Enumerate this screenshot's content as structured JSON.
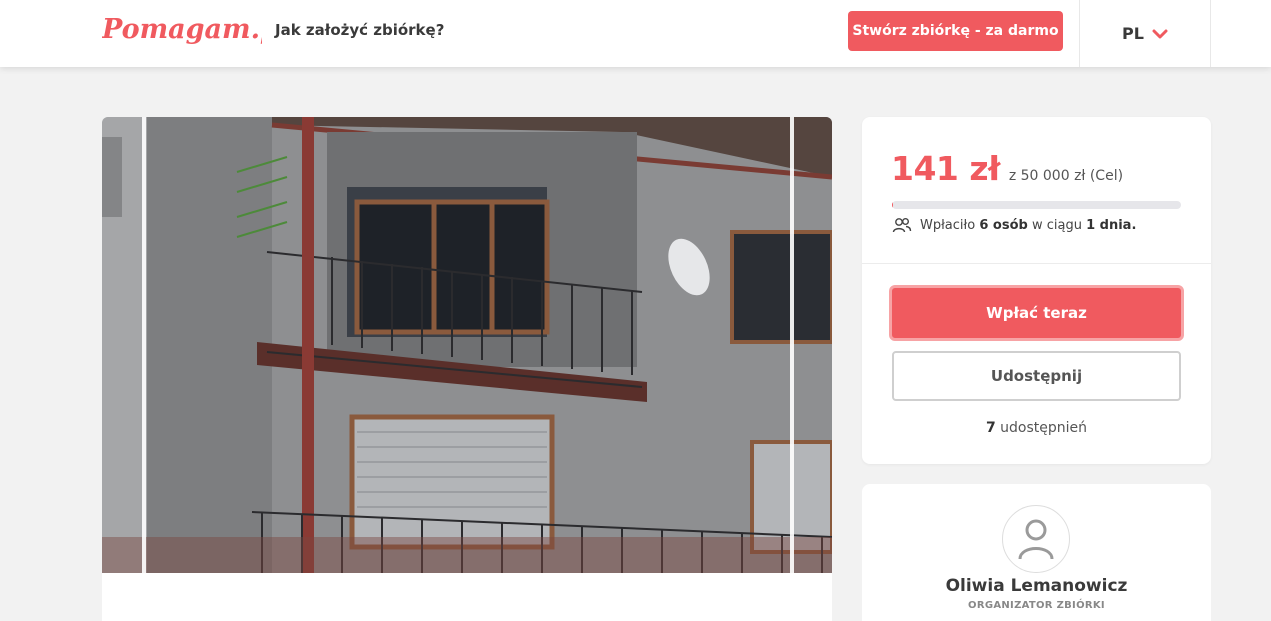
{
  "header": {
    "logo_text": "Pomagam.pl",
    "how_to_link": "Jak założyć zbiórkę?",
    "create_button": "Stwórz zbiórkę - za darmo",
    "language": "PL"
  },
  "campaign": {
    "photo_icon": "burnt-house-photo"
  },
  "donation": {
    "raised": "141 zł",
    "goal_text": "z 50 000 zł (Cel)",
    "progress_fraction": 0.003,
    "donors_prefix": "Wpłaciło",
    "donors_count": "6 osób",
    "donors_middle": "w ciągu",
    "days": "1 dnia.",
    "pay_button": "Wpłać teraz",
    "share_button": "Udostępnij",
    "shares_count": "7",
    "shares_label": "udostępnień"
  },
  "organizer": {
    "name": "Oliwia Lemanowicz",
    "role": "ORGANIZATOR ZBIÓRKI"
  },
  "colors": {
    "accent": "#f05a5f",
    "background": "#f2f2f2"
  }
}
